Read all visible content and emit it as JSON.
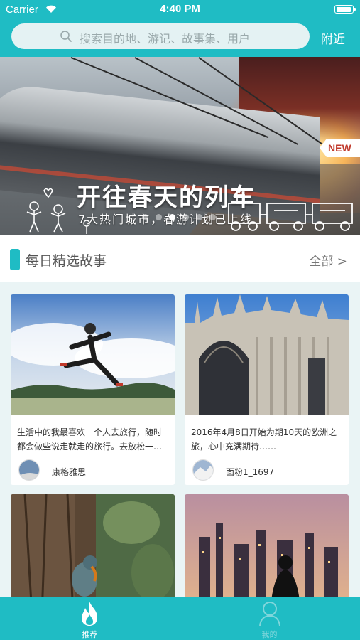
{
  "status": {
    "carrier": "Carrier",
    "time": "4:40 PM"
  },
  "search": {
    "placeholder": "搜索目的地、游记、故事集、用户"
  },
  "header": {
    "nearby_label": "附近"
  },
  "banner": {
    "badge": "NEW",
    "title": "开往春天的列车",
    "subtitle": "7大热门城市，春游计划已上线",
    "page_count": 6,
    "active_page": 3
  },
  "section": {
    "title": "每日精选故事",
    "all_label": "全部 >"
  },
  "stories": [
    {
      "text": "生活中的我最喜欢一个人去旅行，随时都会做些说走就走的旅行。去放松一…",
      "author": "康格雅思"
    },
    {
      "text": "2016年4月8日开始为期10天的欧洲之旅，心中充满期待……",
      "author": "面粉1_1697"
    },
    {
      "text": "",
      "author": ""
    },
    {
      "text": "",
      "author": ""
    }
  ],
  "tabs": [
    {
      "label": "推荐",
      "icon": "flame-icon",
      "active": true
    },
    {
      "label": "我的",
      "icon": "person-icon",
      "active": false
    }
  ],
  "colors": {
    "accent": "#1fbcc4",
    "background": "#eaf4f5"
  }
}
